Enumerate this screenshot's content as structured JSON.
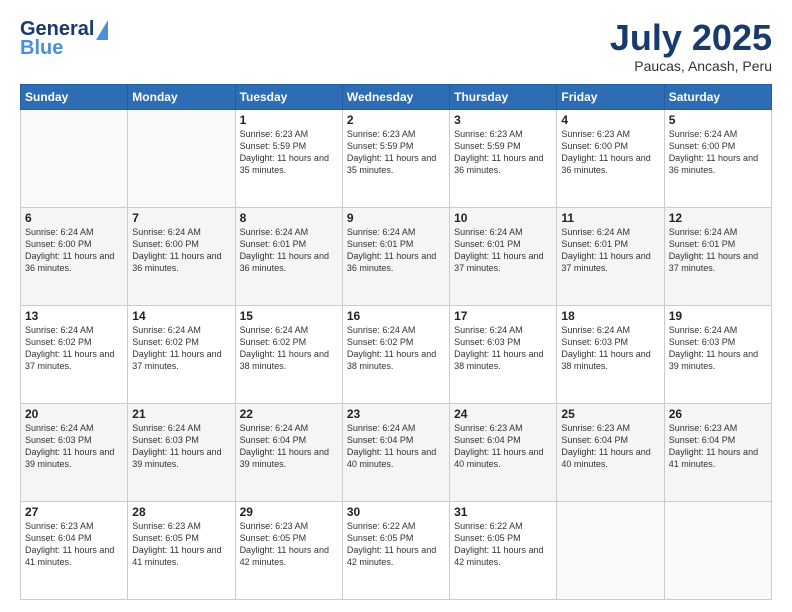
{
  "logo": {
    "line1": "General",
    "line2": "Blue"
  },
  "title": "July 2025",
  "location": "Paucas, Ancash, Peru",
  "days_of_week": [
    "Sunday",
    "Monday",
    "Tuesday",
    "Wednesday",
    "Thursday",
    "Friday",
    "Saturday"
  ],
  "weeks": [
    [
      {
        "day": "",
        "info": ""
      },
      {
        "day": "",
        "info": ""
      },
      {
        "day": "1",
        "info": "Sunrise: 6:23 AM\nSunset: 5:59 PM\nDaylight: 11 hours and 35 minutes."
      },
      {
        "day": "2",
        "info": "Sunrise: 6:23 AM\nSunset: 5:59 PM\nDaylight: 11 hours and 35 minutes."
      },
      {
        "day": "3",
        "info": "Sunrise: 6:23 AM\nSunset: 5:59 PM\nDaylight: 11 hours and 36 minutes."
      },
      {
        "day": "4",
        "info": "Sunrise: 6:23 AM\nSunset: 6:00 PM\nDaylight: 11 hours and 36 minutes."
      },
      {
        "day": "5",
        "info": "Sunrise: 6:24 AM\nSunset: 6:00 PM\nDaylight: 11 hours and 36 minutes."
      }
    ],
    [
      {
        "day": "6",
        "info": "Sunrise: 6:24 AM\nSunset: 6:00 PM\nDaylight: 11 hours and 36 minutes."
      },
      {
        "day": "7",
        "info": "Sunrise: 6:24 AM\nSunset: 6:00 PM\nDaylight: 11 hours and 36 minutes."
      },
      {
        "day": "8",
        "info": "Sunrise: 6:24 AM\nSunset: 6:01 PM\nDaylight: 11 hours and 36 minutes."
      },
      {
        "day": "9",
        "info": "Sunrise: 6:24 AM\nSunset: 6:01 PM\nDaylight: 11 hours and 36 minutes."
      },
      {
        "day": "10",
        "info": "Sunrise: 6:24 AM\nSunset: 6:01 PM\nDaylight: 11 hours and 37 minutes."
      },
      {
        "day": "11",
        "info": "Sunrise: 6:24 AM\nSunset: 6:01 PM\nDaylight: 11 hours and 37 minutes."
      },
      {
        "day": "12",
        "info": "Sunrise: 6:24 AM\nSunset: 6:01 PM\nDaylight: 11 hours and 37 minutes."
      }
    ],
    [
      {
        "day": "13",
        "info": "Sunrise: 6:24 AM\nSunset: 6:02 PM\nDaylight: 11 hours and 37 minutes."
      },
      {
        "day": "14",
        "info": "Sunrise: 6:24 AM\nSunset: 6:02 PM\nDaylight: 11 hours and 37 minutes."
      },
      {
        "day": "15",
        "info": "Sunrise: 6:24 AM\nSunset: 6:02 PM\nDaylight: 11 hours and 38 minutes."
      },
      {
        "day": "16",
        "info": "Sunrise: 6:24 AM\nSunset: 6:02 PM\nDaylight: 11 hours and 38 minutes."
      },
      {
        "day": "17",
        "info": "Sunrise: 6:24 AM\nSunset: 6:03 PM\nDaylight: 11 hours and 38 minutes."
      },
      {
        "day": "18",
        "info": "Sunrise: 6:24 AM\nSunset: 6:03 PM\nDaylight: 11 hours and 38 minutes."
      },
      {
        "day": "19",
        "info": "Sunrise: 6:24 AM\nSunset: 6:03 PM\nDaylight: 11 hours and 39 minutes."
      }
    ],
    [
      {
        "day": "20",
        "info": "Sunrise: 6:24 AM\nSunset: 6:03 PM\nDaylight: 11 hours and 39 minutes."
      },
      {
        "day": "21",
        "info": "Sunrise: 6:24 AM\nSunset: 6:03 PM\nDaylight: 11 hours and 39 minutes."
      },
      {
        "day": "22",
        "info": "Sunrise: 6:24 AM\nSunset: 6:04 PM\nDaylight: 11 hours and 39 minutes."
      },
      {
        "day": "23",
        "info": "Sunrise: 6:24 AM\nSunset: 6:04 PM\nDaylight: 11 hours and 40 minutes."
      },
      {
        "day": "24",
        "info": "Sunrise: 6:23 AM\nSunset: 6:04 PM\nDaylight: 11 hours and 40 minutes."
      },
      {
        "day": "25",
        "info": "Sunrise: 6:23 AM\nSunset: 6:04 PM\nDaylight: 11 hours and 40 minutes."
      },
      {
        "day": "26",
        "info": "Sunrise: 6:23 AM\nSunset: 6:04 PM\nDaylight: 11 hours and 41 minutes."
      }
    ],
    [
      {
        "day": "27",
        "info": "Sunrise: 6:23 AM\nSunset: 6:04 PM\nDaylight: 11 hours and 41 minutes."
      },
      {
        "day": "28",
        "info": "Sunrise: 6:23 AM\nSunset: 6:05 PM\nDaylight: 11 hours and 41 minutes."
      },
      {
        "day": "29",
        "info": "Sunrise: 6:23 AM\nSunset: 6:05 PM\nDaylight: 11 hours and 42 minutes."
      },
      {
        "day": "30",
        "info": "Sunrise: 6:22 AM\nSunset: 6:05 PM\nDaylight: 11 hours and 42 minutes."
      },
      {
        "day": "31",
        "info": "Sunrise: 6:22 AM\nSunset: 6:05 PM\nDaylight: 11 hours and 42 minutes."
      },
      {
        "day": "",
        "info": ""
      },
      {
        "day": "",
        "info": ""
      }
    ]
  ]
}
